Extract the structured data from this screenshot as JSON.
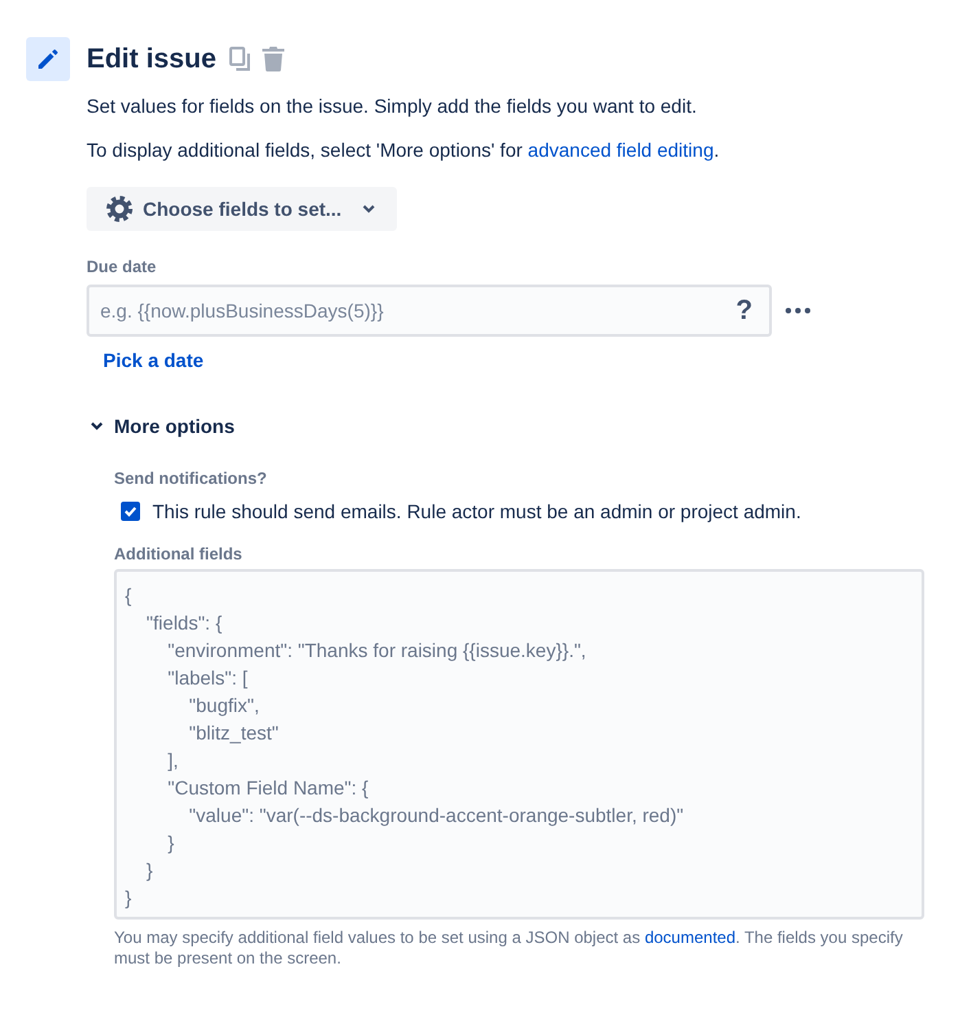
{
  "header": {
    "title": "Edit issue"
  },
  "description": [
    {
      "text": "Set values for fields on the issue. Simply add the fields you want to edit."
    },
    {
      "text": "To display additional fields, select 'More options' for ",
      "link": "advanced field editing",
      "text_after": "."
    }
  ],
  "choose_fields_button": {
    "label": "Choose fields to set..."
  },
  "due_date": {
    "label": "Due date",
    "placeholder": "e.g. {{now.plusBusinessDays(5)}}",
    "help": "?",
    "link": "Pick a date"
  },
  "more_options": {
    "label": "More options",
    "expanded": true,
    "send_notifications": {
      "label": "Send notifications?",
      "option": "This rule should send emails. Rule actor must be an admin or project admin.",
      "checked": true
    },
    "additional_fields": {
      "label": "Additional fields",
      "value": "{\n    \"fields\": {\n        \"environment\": \"Thanks for raising {{issue.key}}.\",\n        \"labels\": [\n            \"bugfix\",\n            \"blitz_test\"\n        ],\n        \"Custom Field Name\": {\n            \"value\": \"var(--ds-background-accent-orange-subtler, red)\"\n        }\n    }\n}",
      "help_text": "You may specify additional field values to be set using a JSON object as ",
      "help_link": "documented",
      "help_text_after": ". The fields you specify must be present on the screen."
    }
  }
}
